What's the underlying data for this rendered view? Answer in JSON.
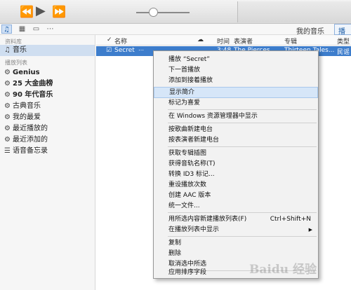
{
  "player": {
    "prev_icon": "rewind-icon",
    "play_icon": "play-icon",
    "next_icon": "fast-forward-icon",
    "volume_level": 0.32
  },
  "toolbar": {
    "views": [
      "music-note-icon",
      "film-icon",
      "tv-icon",
      "more-icon"
    ],
    "my_music": "我的音乐",
    "broadcast": "播放"
  },
  "sidebar": {
    "library_header": "资料库",
    "music": "音乐",
    "playlists_header": "播放列表",
    "playlists": [
      "Genius",
      "25 大金曲榜",
      "90 年代音乐",
      "古典音乐",
      "我的最爱",
      "最近播放的",
      "最近添加的",
      "语音备忘录"
    ]
  },
  "track_list": {
    "columns": {
      "name": "名称",
      "time": "时间",
      "artist": "表演者",
      "album": "专辑",
      "genre": "类型"
    },
    "selected_row": {
      "name": "Secret",
      "time": "3:48",
      "artist": "The Pierces",
      "album": "Thirteen Tales...",
      "genre": "民谣"
    }
  },
  "context_menu": {
    "items": [
      {
        "label": "播放 “Secret”"
      },
      {
        "label": "下一首播放"
      },
      {
        "label": "添加到接着播放"
      },
      {
        "label": "显示简介",
        "highlighted": true
      },
      {
        "label": "标记为喜爱"
      },
      {
        "label": "在 Windows 资源管理器中显示"
      },
      {
        "label": "按歌曲新建电台"
      },
      {
        "label": "按表演者新建电台"
      },
      {
        "label": "获取专辑插图"
      },
      {
        "label": "获得音轨名称(T)"
      },
      {
        "label": "转换 ID3 标记..."
      },
      {
        "label": "重设播放次数"
      },
      {
        "label": "创建 AAC 版本"
      },
      {
        "label": "统一文件..."
      },
      {
        "label": "用所选内容新建播放列表(F)",
        "shortcut": "Ctrl+Shift+N"
      },
      {
        "label": "在播放列表中显示",
        "submenu": true
      },
      {
        "label": "复制"
      },
      {
        "label": "删除"
      },
      {
        "label": "取消选中所选"
      },
      {
        "label": "应用排序字段"
      }
    ]
  },
  "watermark": "Baidu 经验"
}
